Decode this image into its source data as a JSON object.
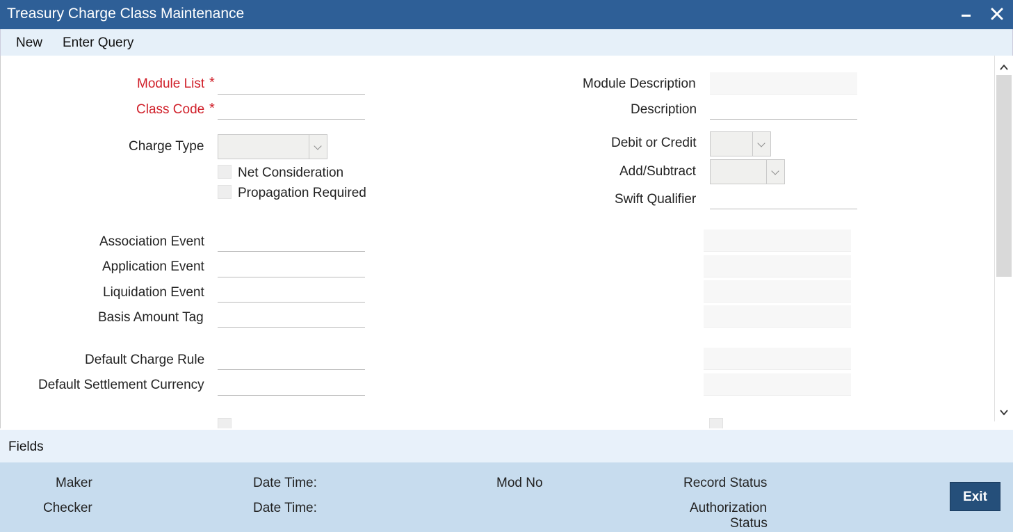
{
  "window": {
    "title": "Treasury Charge Class Maintenance"
  },
  "toolbar": {
    "new_label": "New",
    "enter_query_label": "Enter Query"
  },
  "form": {
    "module_list": {
      "label": "Module List",
      "required_mark": "*",
      "value": ""
    },
    "class_code": {
      "label": "Class Code",
      "required_mark": "*",
      "value": ""
    },
    "charge_type": {
      "label": "Charge Type",
      "value": ""
    },
    "net_consideration": {
      "label": "Net Consideration",
      "checked": false
    },
    "propagation_required": {
      "label": "Propagation Required",
      "checked": false
    },
    "association_event": {
      "label": "Association Event",
      "value": ""
    },
    "application_event": {
      "label": "Application Event",
      "value": ""
    },
    "liquidation_event": {
      "label": "Liquidation Event",
      "value": ""
    },
    "basis_amount_tag": {
      "label": "Basis Amount Tag",
      "value": ""
    },
    "default_charge_rule": {
      "label": "Default Charge Rule",
      "value": ""
    },
    "default_settlement_currency": {
      "label": "Default Settlement Currency",
      "value": ""
    },
    "module_description": {
      "label": "Module Description",
      "value": ""
    },
    "description": {
      "label": "Description",
      "value": ""
    },
    "debit_or_credit": {
      "label": "Debit or Credit",
      "value": ""
    },
    "add_subtract": {
      "label": "Add/Subtract",
      "value": ""
    },
    "swift_qualifier": {
      "label": "Swift Qualifier",
      "value": ""
    }
  },
  "fields_section": {
    "label": "Fields"
  },
  "footer": {
    "maker_label": "Maker",
    "checker_label": "Checker",
    "date_time_label_1": "Date Time:",
    "date_time_label_2": "Date Time:",
    "mod_no_label": "Mod No",
    "record_status_label": "Record Status",
    "authorization_status_line1": "Authorization",
    "authorization_status_line2": "Status",
    "exit_label": "Exit"
  },
  "colors": {
    "titlebar": "#2e5f97",
    "required": "#d0202a",
    "footer": "#c7dcee",
    "exit_button": "#254f7a"
  }
}
